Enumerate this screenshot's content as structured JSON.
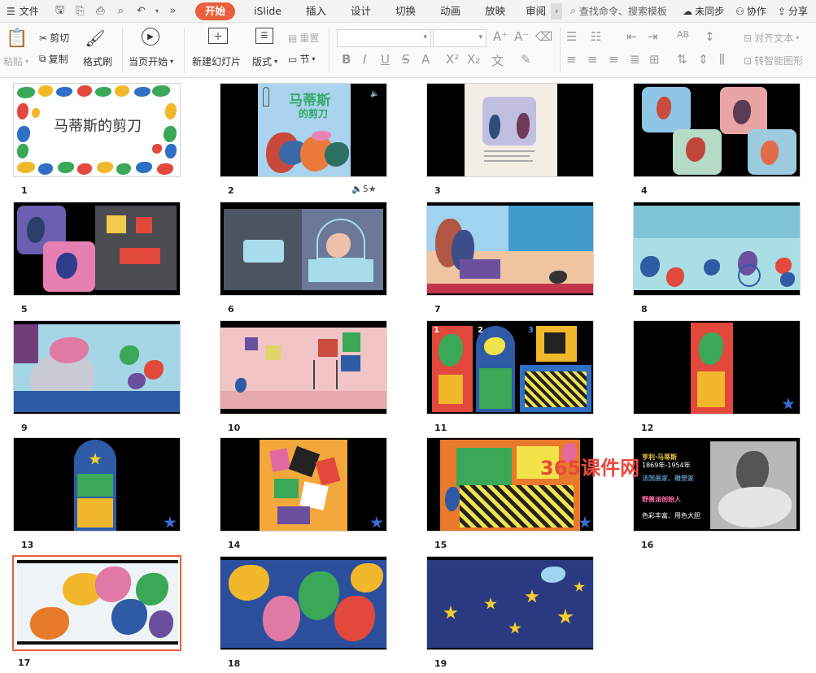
{
  "menubar": {
    "file_label": "文件",
    "tabs": [
      "开始",
      "iSlide",
      "插入",
      "设计",
      "切换",
      "动画",
      "放映",
      "审阅"
    ],
    "active_tab": "开始",
    "search_placeholder": "查找命令、搜索模板",
    "unsynced_label": "未同步",
    "collab_label": "协作",
    "share_label": "分享"
  },
  "ribbon": {
    "paste": "粘贴",
    "cut": "剪切",
    "copy": "复制",
    "format_painter": "格式刷",
    "from_current": "当页开始",
    "new_slide": "新建幻灯片",
    "layout": "版式",
    "section": "节",
    "reset": "重置",
    "align_text": "对齐文本",
    "smartart": "转智能图形"
  },
  "slides": [
    {
      "n": "1",
      "title": "马蒂斯的剪刀"
    },
    {
      "n": "2",
      "title": "马蒂斯",
      "subtitle": "的剪刀",
      "icons": "5★"
    },
    {
      "n": "3"
    },
    {
      "n": "4"
    },
    {
      "n": "5"
    },
    {
      "n": "6"
    },
    {
      "n": "7"
    },
    {
      "n": "8"
    },
    {
      "n": "9"
    },
    {
      "n": "10"
    },
    {
      "n": "11",
      "labels": [
        "1",
        "2",
        "3"
      ]
    },
    {
      "n": "12"
    },
    {
      "n": "13"
    },
    {
      "n": "14"
    },
    {
      "n": "15"
    },
    {
      "n": "16",
      "lines": [
        "亨利·马蒂斯",
        "1869年-1954年",
        "法国画家、雕塑家",
        "野兽派创始人",
        "色彩丰富、用色大胆"
      ]
    },
    {
      "n": "17"
    },
    {
      "n": "18"
    },
    {
      "n": "19"
    }
  ],
  "watermark": "365课件网",
  "colors": {
    "accent": "#e8603c",
    "watermark": "#e84a3c"
  }
}
